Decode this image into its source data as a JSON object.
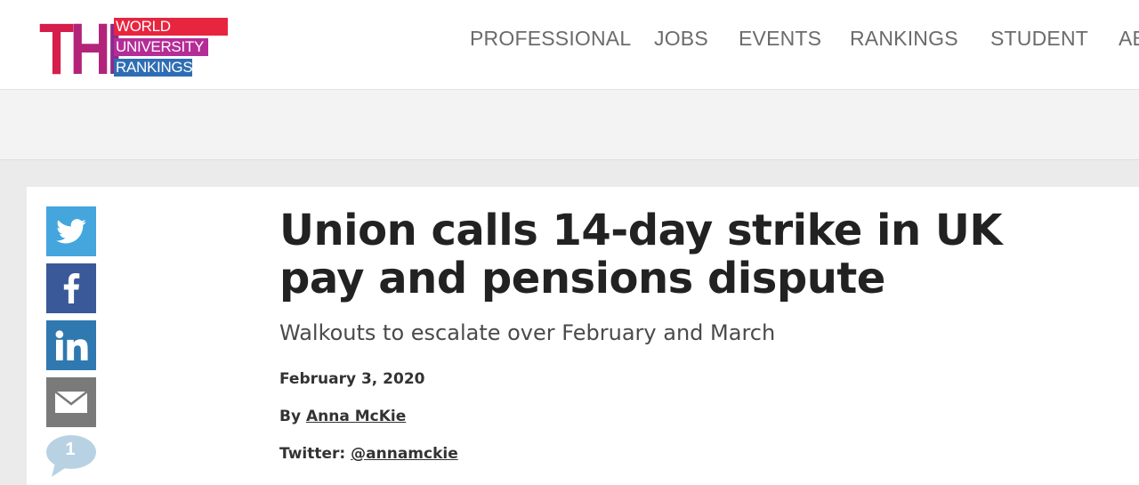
{
  "logo": {
    "the": "THE",
    "line1": "WORLD",
    "line2": "UNIVERSITY",
    "line3": "RANKINGS",
    "colors": [
      "#d51e4b",
      "#e8253f",
      "#b52c97",
      "#2e6db4"
    ]
  },
  "nav": {
    "items": [
      {
        "label": "PROFESSIONAL"
      },
      {
        "label": "JOBS"
      },
      {
        "label": "EVENTS"
      },
      {
        "label": "RANKINGS"
      },
      {
        "label": "STUDENT"
      },
      {
        "label": "AB"
      }
    ]
  },
  "share": {
    "buttons": [
      {
        "icon": "twitter-icon",
        "color": "#44a6dc"
      },
      {
        "icon": "facebook-icon",
        "color": "#3a5998"
      },
      {
        "icon": "linkedin-icon",
        "color": "#2f78b0"
      },
      {
        "icon": "email-icon",
        "color": "#7a7a7a"
      }
    ],
    "comment_count": "1"
  },
  "article": {
    "headline": "Union calls 14-day strike in UK pay and pensions dispute",
    "standfirst": "Walkouts to escalate over February and March",
    "date": "February 3, 2020",
    "byline_prefix": "By",
    "author": "Anna McKie",
    "twitter_prefix": "Twitter:",
    "twitter_handle": "@annamckie"
  }
}
